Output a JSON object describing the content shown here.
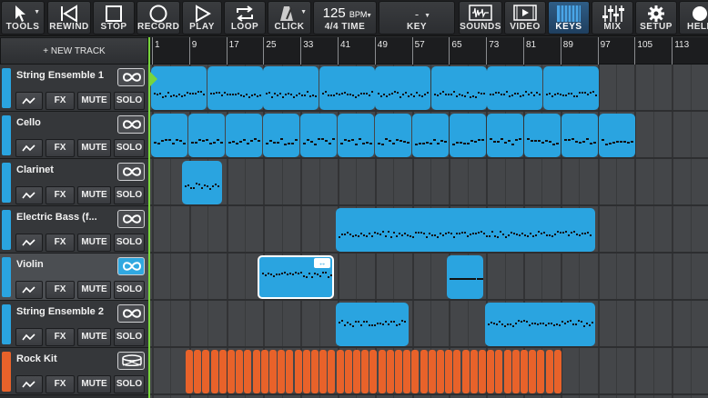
{
  "toolbar": {
    "tools": "TOOLS",
    "rewind": "REWIND",
    "stop": "STOP",
    "record": "RECORD",
    "play": "PLAY",
    "loop": "LOOP",
    "click": "CLICK",
    "tempo_value": "125",
    "tempo_unit": "BPM",
    "time_signature": "4/4 TIME",
    "key_value": "-",
    "key": "KEY",
    "sounds": "SOUNDS",
    "video": "VIDEO",
    "keys": "KEYS",
    "mix": "MIX",
    "setup": "SETUP",
    "help": "HELP"
  },
  "new_track": "+ NEW TRACK",
  "ruler": [
    "1",
    "9",
    "17",
    "25",
    "33",
    "41",
    "49",
    "57",
    "65",
    "73",
    "81",
    "89",
    "97",
    "105",
    "113"
  ],
  "track_buttons": {
    "fx": "FX",
    "mute": "MUTE",
    "solo": "SOLO"
  },
  "tracks": [
    {
      "name": "String Ensemble 1",
      "color": "#2aa4e0",
      "icon": "infinity-icon"
    },
    {
      "name": "Cello",
      "color": "#2aa4e0",
      "icon": "infinity-icon"
    },
    {
      "name": "Clarinet",
      "color": "#2aa4e0",
      "icon": "infinity-icon"
    },
    {
      "name": "Electric Bass (f...",
      "color": "#2aa4e0",
      "icon": "infinity-icon"
    },
    {
      "name": "Violin",
      "color": "#2aa4e0",
      "icon": "infinity-icon",
      "selected": true
    },
    {
      "name": "String Ensemble 2",
      "color": "#2aa4e0",
      "icon": "infinity-icon"
    },
    {
      "name": "Rock Kit",
      "color": "#e8622a",
      "icon": "drum-icon"
    }
  ],
  "colors": {
    "clip": "#2aa4e0",
    "drum": "#e8622a",
    "playhead": "#78d43c"
  }
}
